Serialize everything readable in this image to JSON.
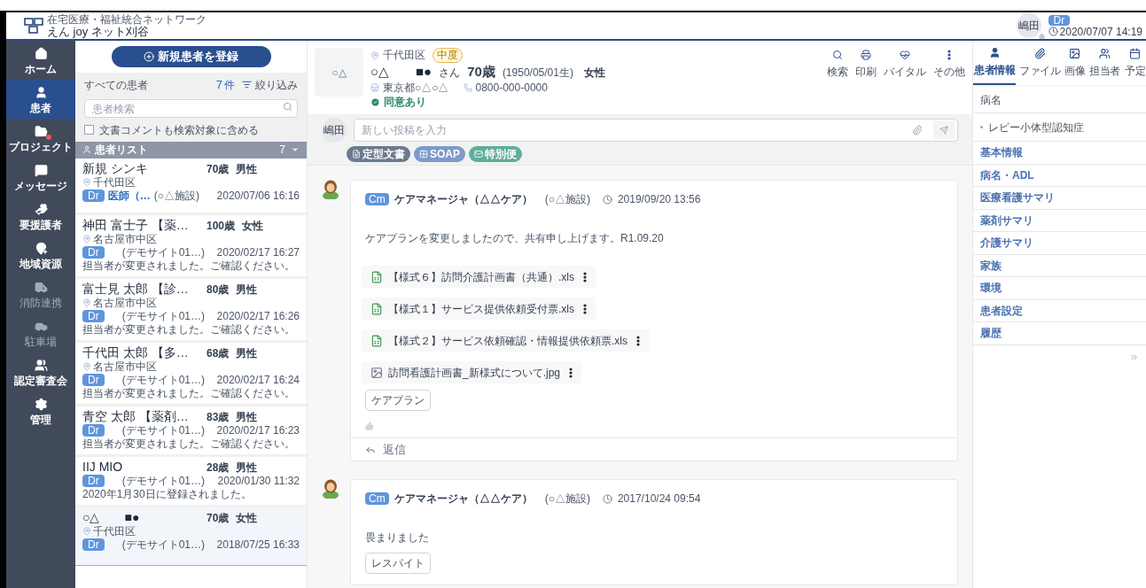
{
  "header": {
    "logo_subtitle": "在宅医療・福祉統合ネットワーク",
    "logo_title": "えん joy ネット刈谷",
    "user_avatar": "嶋田",
    "user_role": "Dr",
    "datetime": "2020/07/07 14:19"
  },
  "nav": [
    {
      "label": "ホーム",
      "selected": false,
      "disabled": false,
      "notification": false
    },
    {
      "label": "患者",
      "selected": true,
      "disabled": false,
      "notification": false
    },
    {
      "label": "プロジェクト",
      "selected": false,
      "disabled": false,
      "notification": true
    },
    {
      "label": "メッセージ",
      "selected": false,
      "disabled": false,
      "notification": false
    },
    {
      "label": "要援護者",
      "selected": false,
      "disabled": false,
      "notification": false
    },
    {
      "label": "地域資源",
      "selected": false,
      "disabled": false,
      "notification": false
    },
    {
      "label": "消防連携",
      "selected": false,
      "disabled": true,
      "notification": false
    },
    {
      "label": "駐車場",
      "selected": false,
      "disabled": true,
      "notification": false
    },
    {
      "label": "認定審査会",
      "selected": false,
      "disabled": false,
      "notification": false
    },
    {
      "label": "管理",
      "selected": false,
      "disabled": false,
      "notification": false
    }
  ],
  "patient_panel": {
    "register_button": "新規患者を登録",
    "filter_label": "すべての患者",
    "count": "7",
    "count_unit": "件",
    "filter_button": "絞り込み",
    "search_placeholder": "患者検索",
    "include_comments": {
      "label": "文書コメントも検索対象に含める",
      "checked": false
    },
    "list_title": "患者リスト",
    "list_count": "7"
  },
  "patients": [
    {
      "name": "新規 シンキ",
      "age": "70歳",
      "gender": "男性",
      "location": "千代田区",
      "role": "Dr",
      "sender": "医師（…",
      "facility": "(○△施設)",
      "date": "2020/07/06 16:16",
      "selected": false
    },
    {
      "name": "神田 富士子 【薬…",
      "age": "100歳",
      "gender": "女性",
      "location": "名古屋市中区",
      "role": "Dr",
      "facility": "(デモサイト01…)",
      "date": "2020/02/17 16:27",
      "message": "担当者が変更されました。ご確認ください。",
      "selected": false
    },
    {
      "name": "富士見 太郎 【診…",
      "age": "80歳",
      "gender": "男性",
      "location": "名古屋市中区",
      "role": "Dr",
      "facility": "(デモサイト01…)",
      "date": "2020/02/17 16:26",
      "message": "担当者が変更されました。ご確認ください。",
      "selected": false
    },
    {
      "name": "千代田 太郎 【多…",
      "age": "68歳",
      "gender": "男性",
      "location": "名古屋市中区",
      "role": "Dr",
      "facility": "(デモサイト01…)",
      "date": "2020/02/17 16:24",
      "message": "担当者が変更されました。ご確認ください。",
      "selected": false
    },
    {
      "name": "青空 太郎 【薬剤…",
      "age": "83歳",
      "gender": "男性",
      "role": "Dr",
      "facility": "(デモサイト01…)",
      "date": "2020/02/17 16:23",
      "message": "担当者が変更されました。ご確認ください。",
      "selected": false
    },
    {
      "name": "IIJ MIO",
      "age": "28歳",
      "gender": "男性",
      "role": "Dr",
      "facility": "(デモサイト01…)",
      "date": "2020/01/30 11:32",
      "message": "2020年1月30日に登録されました。",
      "selected": false
    },
    {
      "name": "○△　　■●",
      "age": "70歳",
      "gender": "女性",
      "location": "千代田区",
      "role": "Dr",
      "facility": "(デモサイト01…)",
      "date": "2018/07/25 16:33",
      "selected": true
    }
  ],
  "patient": {
    "avatar": "○△",
    "location": "千代田区",
    "care_level": "中度",
    "name": "○△　　■●",
    "honorific": "さん",
    "age": "70歳",
    "birth": "(1950/05/01生)",
    "gender": "女性",
    "address": "東京都○△○△",
    "phone": "0800-000-0000",
    "consent": "同意あり"
  },
  "toolbar": [
    {
      "label": "検索"
    },
    {
      "label": "印刷"
    },
    {
      "label": "バイタル"
    },
    {
      "label": "その他"
    }
  ],
  "composer": {
    "avatar": "嶋田",
    "placeholder": "新しい投稿を入力",
    "templates": [
      {
        "label": "定型文書",
        "color": "#6b7a90"
      },
      {
        "label": "SOAP",
        "color": "#7d9ac8"
      },
      {
        "label": "特別便",
        "color": "#5fae9d"
      }
    ]
  },
  "posts": [
    {
      "role": "Cm",
      "author": "ケアマネージャ（△△ケア）",
      "facility": "(○△施設)",
      "date": "2019/09/20 13:56",
      "body": "ケアプランを変更しましたので、共有申し上げます。R1.09.20",
      "attachments": [
        {
          "kind": "spreadsheet",
          "name": "【様式６】訪問介護計画書（共通）.xls"
        },
        {
          "kind": "spreadsheet",
          "name": "【様式１】サービス提供依頼受付票.xls"
        },
        {
          "kind": "spreadsheet",
          "name": "【様式２】サービス依頼確認・情報提供依頼票.xls"
        },
        {
          "kind": "image",
          "name": "訪問看護計画書_新様式について.jpg"
        }
      ],
      "tags": [
        "ケアプラン"
      ],
      "reply": "返信"
    },
    {
      "role": "Cm",
      "author": "ケアマネージャ（△△ケア）",
      "facility": "(○△施設)",
      "date": "2017/10/24 09:54",
      "body": "畏まりました",
      "tags": [
        "レスパイト"
      ]
    }
  ],
  "info_panel": {
    "tabs": [
      {
        "label": "患者情報",
        "selected": true
      },
      {
        "label": "ファイル",
        "selected": false
      },
      {
        "label": "画像",
        "selected": false
      },
      {
        "label": "担当者",
        "selected": false
      },
      {
        "label": "予定",
        "selected": false
      }
    ],
    "section_title": "病名",
    "diseases": [
      "レビー小体型認知症"
    ],
    "links": [
      "基本情報",
      "病名・ADL",
      "医療看護サマリ",
      "薬剤サマリ",
      "介護サマリ",
      "家族",
      "環境",
      "患者設定",
      "履歴"
    ]
  }
}
